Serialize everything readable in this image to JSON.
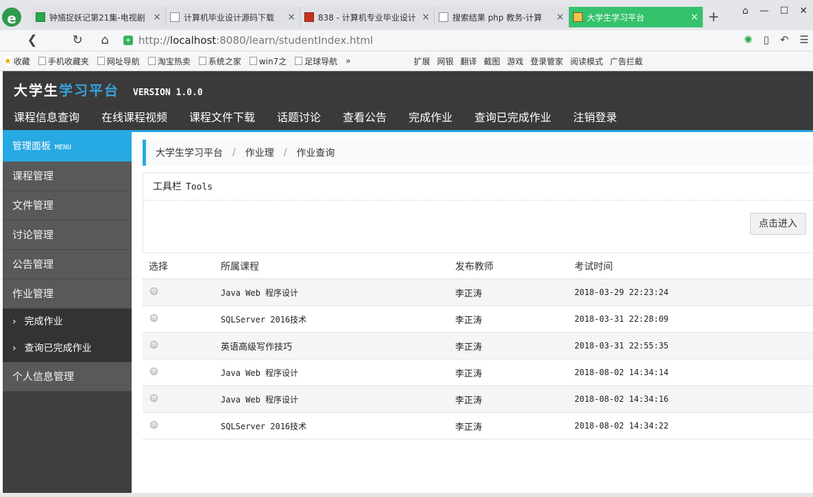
{
  "browser": {
    "logo_glyph": "e",
    "tabs": [
      {
        "title": "钟馗捉妖记第21集-电视剧",
        "fav": "green"
      },
      {
        "title": "计算机毕业设计源码下载",
        "fav": "doc"
      },
      {
        "title": "838 - 计算机专业毕业设计",
        "fav": "red"
      },
      {
        "title": "搜索结果 php 教务-计算",
        "fav": "doc"
      },
      {
        "title": "大学生学习平台",
        "fav": "img"
      }
    ],
    "active_tab": 4,
    "close_glyph": "×",
    "newtab_glyph": "+",
    "window_controls": [
      "⌂",
      "—",
      "☐",
      "✕"
    ],
    "url_prefix": "http://",
    "url_host": "localhost",
    "url_rest": ":8080/learn/studentIndex.html",
    "bookmarks_left": [
      "收藏",
      "手机收藏夹",
      "网址导航",
      "淘宝热卖",
      "系统之家",
      "win7之",
      "足球导航"
    ],
    "more_glyph": "»",
    "bookmarks_right": [
      "扩展",
      "网银",
      "翻译",
      "截图",
      "游戏",
      "登录管家",
      "阅读模式",
      "广告拦截"
    ]
  },
  "site": {
    "brand_white": "大学生",
    "brand_blue": "学习平台",
    "version": "VERSION 1.0.0",
    "nav": [
      "课程信息查询",
      "在线课程视频",
      "课程文件下载",
      "话题讨论",
      "查看公告",
      "完成作业",
      "查询已完成作业",
      "注销登录"
    ]
  },
  "sidebar": {
    "head": "管理面板",
    "head_en": "MENU",
    "items_top": [
      "课程管理",
      "文件管理",
      "讨论管理",
      "公告管理",
      "作业管理"
    ],
    "sub_items": [
      "完成作业",
      "查询已完成作业"
    ],
    "items_bottom": [
      "个人信息管理"
    ]
  },
  "breadcrumb": [
    "大学生学习平台",
    "作业理",
    "作业查询"
  ],
  "toolbar": {
    "title": "工具栏",
    "title_en": "Tools",
    "enter_label": "点击进入"
  },
  "table": {
    "headers": [
      "选择",
      "所属课程",
      "发布教师",
      "考试时间"
    ],
    "rows": [
      {
        "course": "Java Web 程序设计",
        "teacher": "李正涛",
        "time": "2018-03-29 22:23:24"
      },
      {
        "course": "SQLServer 2016技术",
        "teacher": "李正涛",
        "time": "2018-03-31 22:28:09"
      },
      {
        "course": "英语高级写作技巧",
        "teacher": "李正涛",
        "time": "2018-03-31 22:55:35"
      },
      {
        "course": "Java Web 程序设计",
        "teacher": "李正涛",
        "time": "2018-08-02 14:34:14"
      },
      {
        "course": "Java Web 程序设计",
        "teacher": "李正涛",
        "time": "2018-08-02 14:34:16"
      },
      {
        "course": "SQLServer 2016技术",
        "teacher": "李正涛",
        "time": "2018-08-02 14:34:22"
      }
    ]
  },
  "colors": {
    "accent": "#27a9e3",
    "header_bg": "#3a3a3a",
    "sidebar_item_bg": "#595959",
    "active_tab": "#34c26c"
  }
}
